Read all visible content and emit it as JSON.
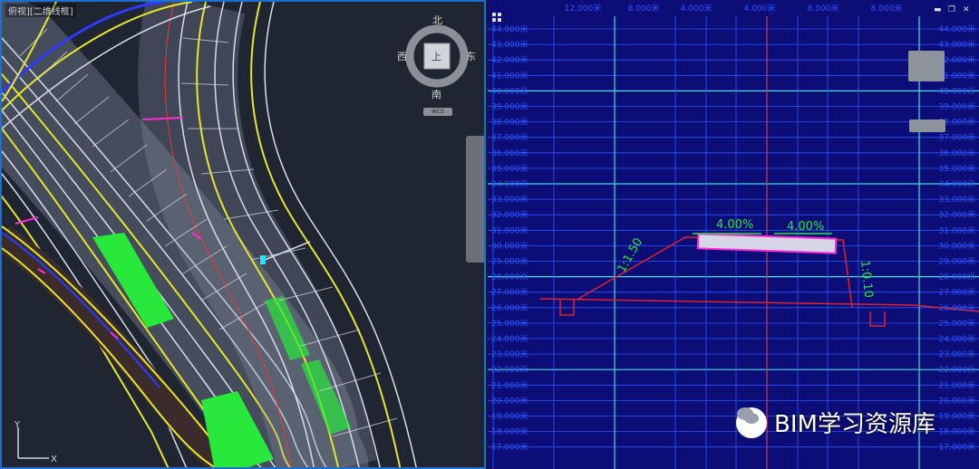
{
  "left_viewport": {
    "title": "俯视][二维线框]",
    "compass": {
      "north": "北",
      "south": "南",
      "east": "东",
      "west": "西",
      "top": "上"
    },
    "wcs": "WCS"
  },
  "right_viewport": {
    "top_ruler": [
      "12.000米",
      "8.000米",
      "4.000米",
      "4.000米",
      "8.000米",
      "8.000米"
    ],
    "elevations": [
      "44.000米",
      "43.000米",
      "42.000米",
      "41.000米",
      "40.000米",
      "39.000米",
      "38.000米",
      "37.000米",
      "36.000米",
      "35.000米",
      "34.000米",
      "33.000米",
      "32.000米",
      "31.000米",
      "30.000米",
      "29.000米",
      "28.000米",
      "27.000米",
      "26.000米",
      "25.000米",
      "24.000米",
      "23.000米",
      "22.000米",
      "21.000米",
      "20.000米",
      "19.000米",
      "18.000米",
      "17.000米"
    ],
    "annotations": {
      "left_slope_grade": "4.00%",
      "right_slope_grade": "4.00%",
      "left_side_slope": "1:1.50",
      "right_side_slope": "1:0.10"
    },
    "window_controls": {
      "minimize": "▬",
      "restore": "❐",
      "close": "✕"
    }
  },
  "watermark": {
    "text": "BIM学习资源库"
  },
  "colors": {
    "left_bg": "#202532",
    "right_bg": "#0d0d78",
    "active_border": "#1d6fd0",
    "grid_cyan": "#3ee0e0",
    "grid_blue": "#2b57ff",
    "red": "#e0212b",
    "green": "#27e83b",
    "magenta": "#ff2bd6"
  }
}
